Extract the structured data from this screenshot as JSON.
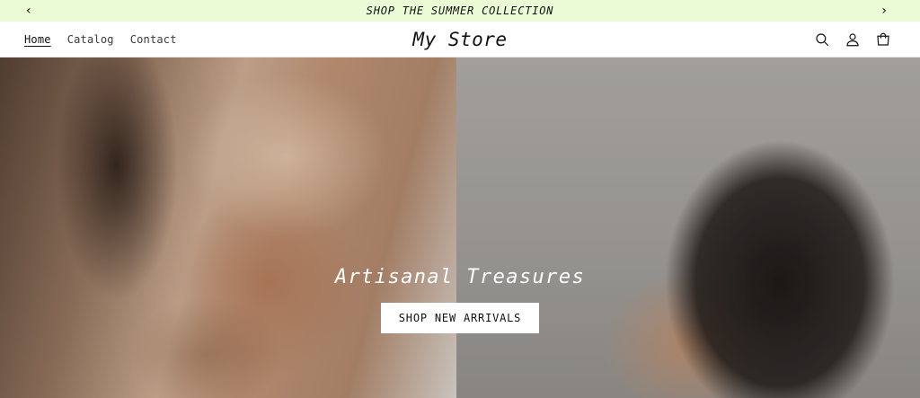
{
  "colors": {
    "announcement_bg": "#eafbd6",
    "text": "#121212",
    "button_bg": "#ffffff"
  },
  "announcement": {
    "text": "SHOP THE SUMMER COLLECTION",
    "prev_icon": "chevron-left-icon",
    "next_icon": "chevron-right-icon",
    "prev_glyph": "‹",
    "next_glyph": "›"
  },
  "header": {
    "nav": [
      {
        "label": "Home",
        "active": true
      },
      {
        "label": "Catalog",
        "active": false
      },
      {
        "label": "Contact",
        "active": false
      }
    ],
    "logo": "My Store",
    "icons": [
      "search-icon",
      "account-icon",
      "cart-icon"
    ]
  },
  "hero": {
    "title": "Artisanal Treasures",
    "button_label": "SHOP NEW ARRIVALS",
    "images": [
      "hand-with-ring-at-neck-image",
      "hand-with-rings-in-hair-image"
    ]
  }
}
